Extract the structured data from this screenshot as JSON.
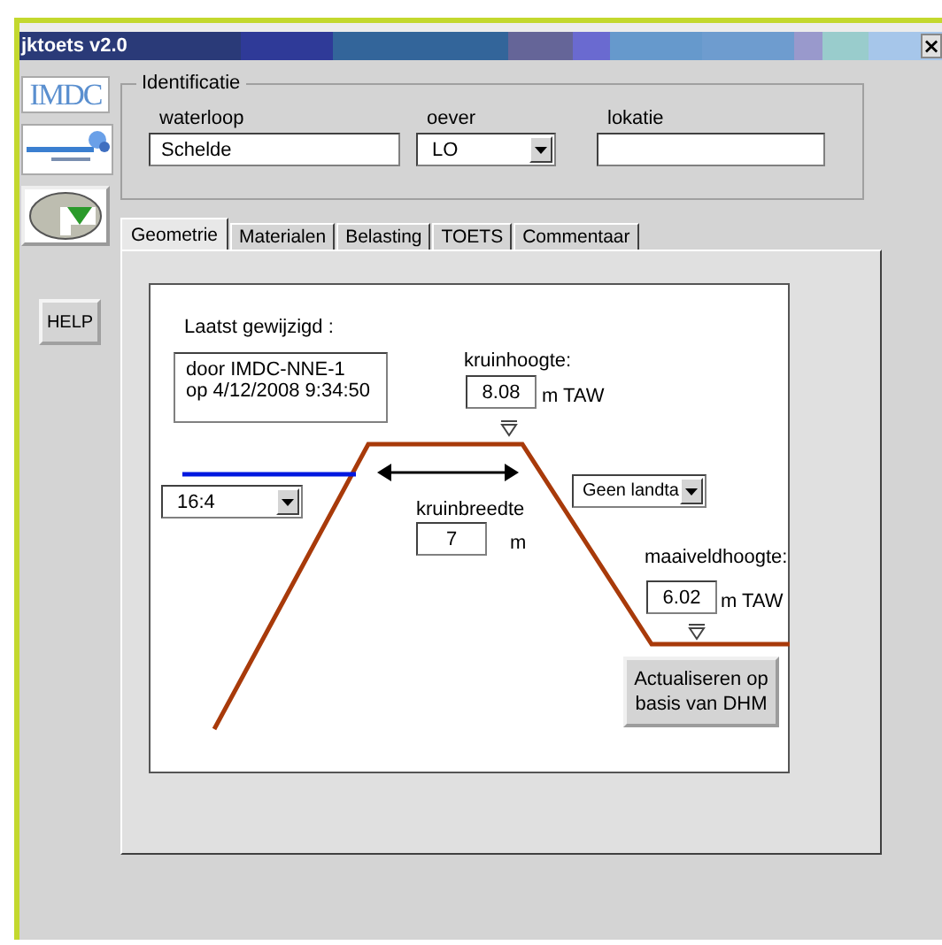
{
  "window": {
    "title": "jktoets v2.0",
    "close": "×"
  },
  "logos": {
    "imdc": "IMDC"
  },
  "help_button": "HELP",
  "identificatie": {
    "title": "Identificatie",
    "fields": [
      {
        "label": "waterloop",
        "value": "Schelde",
        "kind": "text"
      },
      {
        "label": "oever",
        "value": "LO",
        "kind": "dropdown"
      },
      {
        "label": "lokatie",
        "kind": "text"
      }
    ]
  },
  "tabs": [
    {
      "label": "Geometrie",
      "selected": true
    },
    {
      "label": "Materialen",
      "selected": false
    },
    {
      "label": "Belasting",
      "selected": false
    },
    {
      "label": "TOETS",
      "selected": false
    },
    {
      "label": "Commentaar",
      "selected": false
    }
  ],
  "geometrie": {
    "last_modified_label": "Laatst gewijzigd :",
    "last_modified_lines": [
      "door IMDC-NNE-1",
      "op 4/12/2008 9:34:50"
    ],
    "kruinhoogte": {
      "label": "kruinhoogte:",
      "value": "8.08",
      "unit": "m TAW"
    },
    "slope": {
      "value": "16:4"
    },
    "kruinbreedte": {
      "label": "kruinbreedte",
      "value": "7",
      "unit": "m"
    },
    "landside": {
      "value": "Geen landta"
    },
    "maaiveldhoogte": {
      "label": "maaiveldhoogte:",
      "value": "6.02",
      "unit": "m TAW"
    },
    "update_button": "Actualiseren op basis van DHM"
  }
}
